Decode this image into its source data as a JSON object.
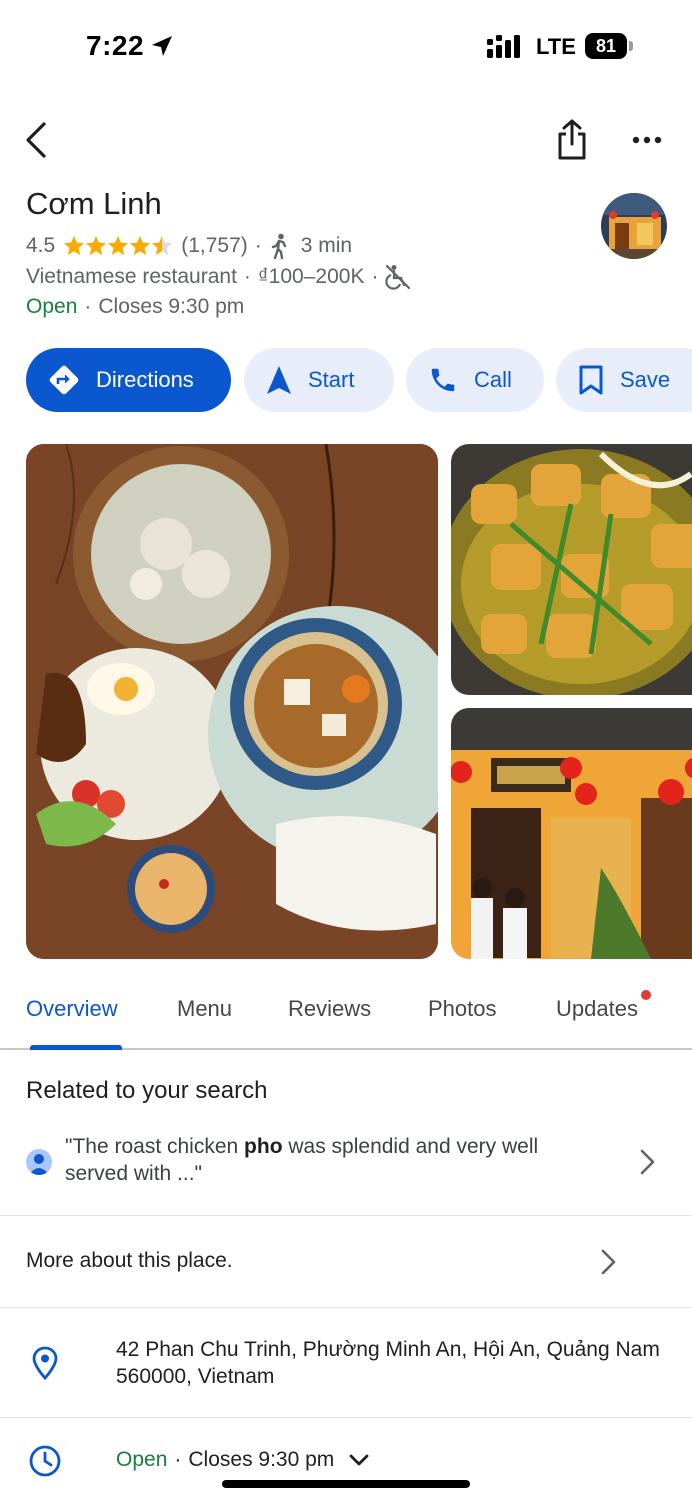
{
  "status_bar": {
    "time": "7:22",
    "network": "LTE",
    "battery": "81"
  },
  "place": {
    "name": "Cơm Linh",
    "rating": "4.5",
    "rating_stars": 4.5,
    "review_count": "(1,757)",
    "walk_time": "3 min",
    "category": "Vietnamese restaurant",
    "price": "₫100–200K",
    "open_status": "Open",
    "closes": "Closes 9:30 pm"
  },
  "actions": {
    "directions": "Directions",
    "start": "Start",
    "call": "Call",
    "save": "Save"
  },
  "tabs": [
    {
      "label": "Overview",
      "active": true
    },
    {
      "label": "Menu",
      "active": false
    },
    {
      "label": "Reviews",
      "active": false
    },
    {
      "label": "Photos",
      "active": false
    },
    {
      "label": "Updates",
      "active": false
    }
  ],
  "related": {
    "title": "Related to your search",
    "quote_before": "\"The roast chicken ",
    "quote_bold": "pho",
    "quote_after": " was splendid and very well served with ...\""
  },
  "more_about": "More about this place.",
  "address": "42 Phan Chu Trinh, Phường Minh An, Hội An, Quảng Nam 560000, Vietnam",
  "hours": {
    "status": "Open",
    "closes": "Closes 9:30 pm"
  },
  "colors": {
    "accent": "#0b57d0",
    "open": "#188038",
    "star": "#f9ab00",
    "chip_bg": "#e8eef9"
  }
}
